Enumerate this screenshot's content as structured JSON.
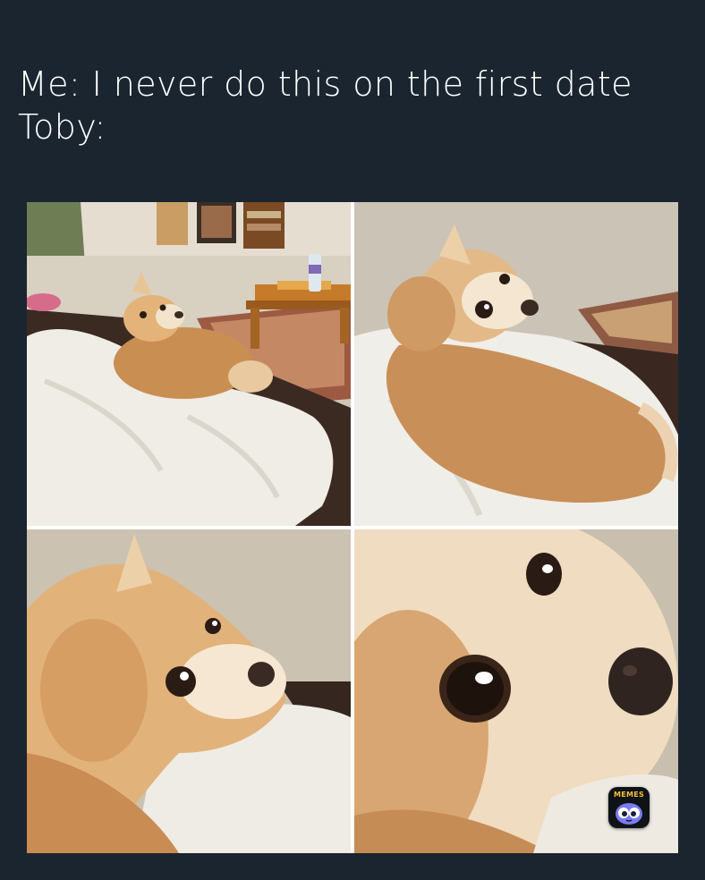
{
  "caption": {
    "line1": "Me: I never do this on the first date",
    "line2": "Toby:"
  },
  "photos": [
    {
      "subject": "dog-on-blanket-wide"
    },
    {
      "subject": "dog-looking-back-medium"
    },
    {
      "subject": "dog-face-close"
    },
    {
      "subject": "dog-eye-extreme-close"
    }
  ],
  "badge": {
    "label": "MEMES",
    "icon": "owl-mascot-icon",
    "accent": "#f3c23a",
    "mascot_color": "#7b7cf0"
  },
  "colors": {
    "background": "#1b2530",
    "caption_text": "#ffffff",
    "grid_gap": "#ffffff"
  }
}
